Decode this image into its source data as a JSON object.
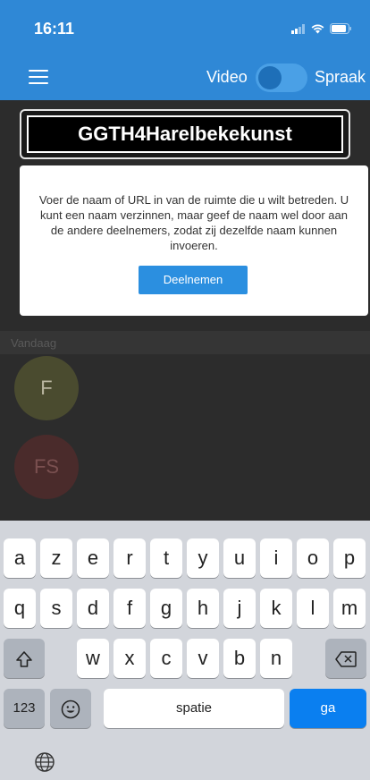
{
  "status": {
    "time": "16:11"
  },
  "toolbar": {
    "mode_video": "Video",
    "mode_spraak": "Spraak"
  },
  "room": {
    "name": "GGTH4Harelbekekunst"
  },
  "dialog": {
    "info": "Voer de naam of URL in van de ruimte die u wilt betreden. U kunt een naam verzinnen, maar geef de naam wel door aan de andere deelnemers, zodat zij dezelfde naam kunnen invoeren.",
    "join_label": "Deelnemen"
  },
  "recent": {
    "header": "Vandaag",
    "items": [
      {
        "initials": "F"
      },
      {
        "initials": "FS"
      }
    ]
  },
  "keyboard": {
    "row1": [
      "a",
      "z",
      "e",
      "r",
      "t",
      "y",
      "u",
      "i",
      "o",
      "p"
    ],
    "row2": [
      "q",
      "s",
      "d",
      "f",
      "g",
      "h",
      "j",
      "k",
      "l",
      "m"
    ],
    "row3": [
      "w",
      "x",
      "c",
      "v",
      "b",
      "n"
    ],
    "numbers_label": "123",
    "space_label": "spatie",
    "go_label": "ga"
  },
  "colors": {
    "accent": "#2f88d6",
    "go_key": "#0a7ff0"
  }
}
